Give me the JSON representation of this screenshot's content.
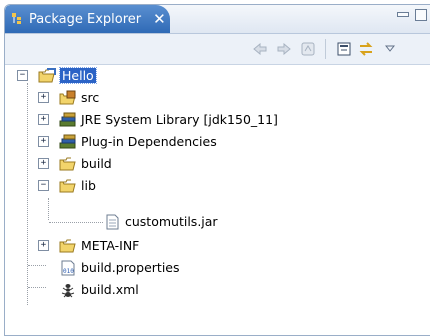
{
  "view": {
    "title": "Package Explorer",
    "close_label": "✕"
  },
  "toolbar": {
    "back_icon": "back-arrow-icon",
    "forward_icon": "forward-arrow-icon",
    "up_icon": "go-into-icon",
    "collapse_icon": "collapse-all-icon",
    "link_icon": "link-with-editor-icon",
    "menu_icon": "view-menu-icon"
  },
  "tree": {
    "project": "Hello",
    "src": "src",
    "jre": "JRE System Library [jdk150_11]",
    "plugins": "Plug-in Dependencies",
    "build": "build",
    "lib": "lib",
    "jar": "customutils.jar",
    "metainf": "META-INF",
    "buildprops": "build.properties",
    "buildxml": "build.xml"
  },
  "colors": {
    "selection": "#2b63c6",
    "tab": "#3d78c2",
    "folder": "#e8c24a"
  }
}
